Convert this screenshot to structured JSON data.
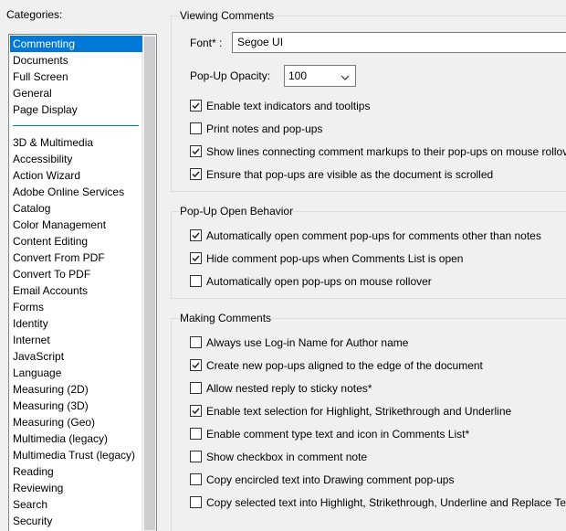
{
  "categories": {
    "title": "Categories:",
    "items": [
      {
        "label": "Commenting",
        "selected": true
      },
      {
        "label": "Documents"
      },
      {
        "label": "Full Screen"
      },
      {
        "label": "General"
      },
      {
        "label": "Page Display"
      },
      {
        "label": "3D & Multimedia"
      },
      {
        "label": "Accessibility"
      },
      {
        "label": "Action Wizard"
      },
      {
        "label": "Adobe Online Services"
      },
      {
        "label": "Catalog"
      },
      {
        "label": "Color Management"
      },
      {
        "label": "Content Editing"
      },
      {
        "label": "Convert From PDF"
      },
      {
        "label": "Convert To PDF"
      },
      {
        "label": "Email Accounts"
      },
      {
        "label": "Forms"
      },
      {
        "label": "Identity"
      },
      {
        "label": "Internet"
      },
      {
        "label": "JavaScript"
      },
      {
        "label": "Language"
      },
      {
        "label": "Measuring (2D)"
      },
      {
        "label": "Measuring (3D)"
      },
      {
        "label": "Measuring (Geo)"
      },
      {
        "label": "Multimedia (legacy)"
      },
      {
        "label": "Multimedia Trust (legacy)"
      },
      {
        "label": "Reading"
      },
      {
        "label": "Reviewing"
      },
      {
        "label": "Search"
      },
      {
        "label": "Security"
      }
    ]
  },
  "viewing": {
    "title": "Viewing Comments",
    "font_label": "Font* :",
    "font_value": "Segoe UI",
    "opacity_label": "Pop-Up Opacity:",
    "opacity_value": "100",
    "checks": [
      {
        "label": "Enable text indicators and tooltips",
        "checked": true
      },
      {
        "label": "Print notes and pop-ups",
        "checked": false
      },
      {
        "label": "Show lines connecting comment markups to their pop-ups on mouse rollover",
        "checked": true
      },
      {
        "label": "Ensure that pop-ups are visible as the document is scrolled",
        "checked": true
      }
    ]
  },
  "popup": {
    "title": "Pop-Up Open Behavior",
    "checks": [
      {
        "label": "Automatically open comment pop-ups for comments other than notes",
        "checked": true
      },
      {
        "label": "Hide comment pop-ups when Comments List is open",
        "checked": true
      },
      {
        "label": "Automatically open pop-ups on mouse rollover",
        "checked": false
      }
    ]
  },
  "making": {
    "title": "Making Comments",
    "checks": [
      {
        "label": "Always use Log-in Name for Author name",
        "checked": false
      },
      {
        "label": "Create new pop-ups aligned to the edge of the document",
        "checked": true
      },
      {
        "label": "Allow nested reply to sticky notes*",
        "checked": false
      },
      {
        "label": "Enable text selection for Highlight, Strikethrough and Underline",
        "checked": true
      },
      {
        "label": "Enable comment type text and icon in Comments List*",
        "checked": false
      },
      {
        "label": "Show checkbox in comment note",
        "checked": false
      },
      {
        "label": "Copy encircled text into Drawing comment pop-ups",
        "checked": false
      },
      {
        "label": "Copy selected text into Highlight, Strikethrough, Underline and Replace Text",
        "checked": false
      }
    ]
  }
}
